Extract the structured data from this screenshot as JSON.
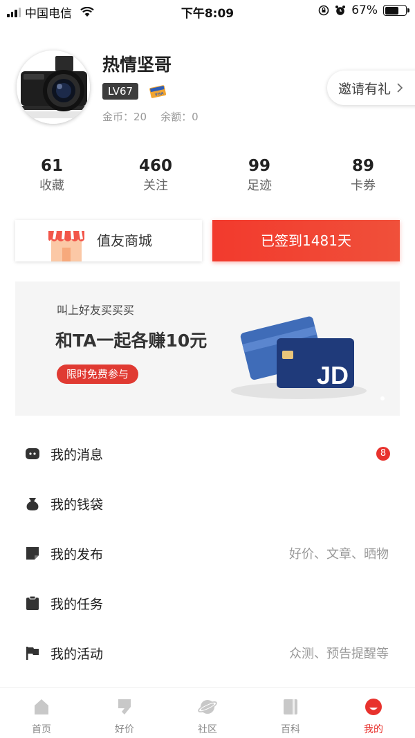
{
  "status_bar": {
    "carrier": "中国电信",
    "time": "下午8:09",
    "battery": "67%",
    "battery_level": 0.67
  },
  "profile": {
    "username": "热情坚哥",
    "level": "LV67",
    "coins_label": "金币：20",
    "balance_label": "余额：0",
    "invite_label": "邀请有礼"
  },
  "stats": [
    {
      "value": "61",
      "label": "收藏"
    },
    {
      "value": "460",
      "label": "关注"
    },
    {
      "value": "99",
      "label": "足迹"
    },
    {
      "value": "89",
      "label": "卡券"
    }
  ],
  "actions": {
    "mall_label": "值友商城",
    "checkin_label": "已签到1481天"
  },
  "banner": {
    "subtitle": "叫上好友买买买",
    "title": "和TA一起各赚10元",
    "button": "限时免费参与",
    "card_text": "JD"
  },
  "menu": [
    {
      "label": "我的消息",
      "icon": "message-icon",
      "badge": "8",
      "hint": ""
    },
    {
      "label": "我的钱袋",
      "icon": "money-bag-icon",
      "badge": "",
      "hint": ""
    },
    {
      "label": "我的发布",
      "icon": "post-icon",
      "badge": "",
      "hint": "好价、文章、晒物"
    },
    {
      "label": "我的任务",
      "icon": "task-clipboard-icon",
      "badge": "",
      "hint": ""
    },
    {
      "label": "我的活动",
      "icon": "flag-icon",
      "badge": "",
      "hint": "众测、预告提醒等"
    }
  ],
  "tabs": [
    {
      "label": "首页",
      "icon": "home-icon",
      "active": false
    },
    {
      "label": "好价",
      "icon": "deal-tag-icon",
      "active": false
    },
    {
      "label": "社区",
      "icon": "planet-icon",
      "active": false
    },
    {
      "label": "百科",
      "icon": "book-icon",
      "active": false
    },
    {
      "label": "我的",
      "icon": "profile-icon",
      "active": true
    }
  ],
  "colors": {
    "accent": "#e8322d",
    "text": "#222222",
    "muted": "#999999"
  }
}
